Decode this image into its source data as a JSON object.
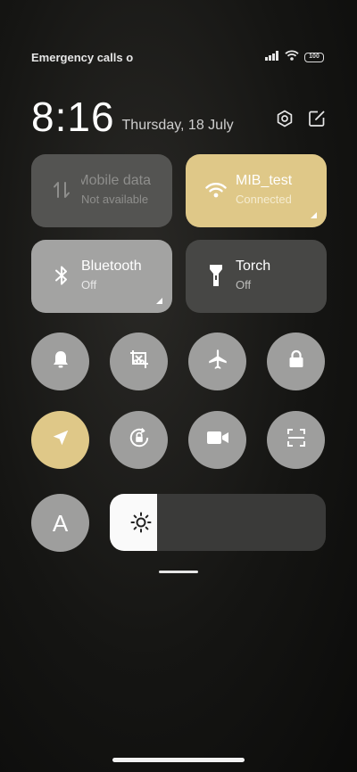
{
  "status_bar": {
    "carrier": "Emergency calls o",
    "battery": "100"
  },
  "header": {
    "time": "8:16",
    "date": "Thursday, 18 July"
  },
  "tiles": {
    "mobile_data": {
      "title": "Mobile data",
      "subtitle": "Not available"
    },
    "wifi": {
      "title": "MIB_test",
      "subtitle": "Connected"
    },
    "bluetooth": {
      "title": "Bluetooth",
      "subtitle": "Off"
    },
    "torch": {
      "title": "Torch",
      "subtitle": "Off"
    }
  },
  "toggles_row1": [
    "bell-icon",
    "screenshot-icon",
    "airplane-icon",
    "lock-icon"
  ],
  "toggles_row2": [
    "location-icon",
    "auto-rotate-lock-icon",
    "video-camera-icon",
    "scan-icon"
  ],
  "font_toggle": {
    "label": "A"
  },
  "brightness": {
    "level": 0.22
  },
  "colors": {
    "accent": "#dfc888",
    "tile_off": "#474745",
    "tile_disabled": "#545452",
    "round_off": "#9e9e9d"
  }
}
